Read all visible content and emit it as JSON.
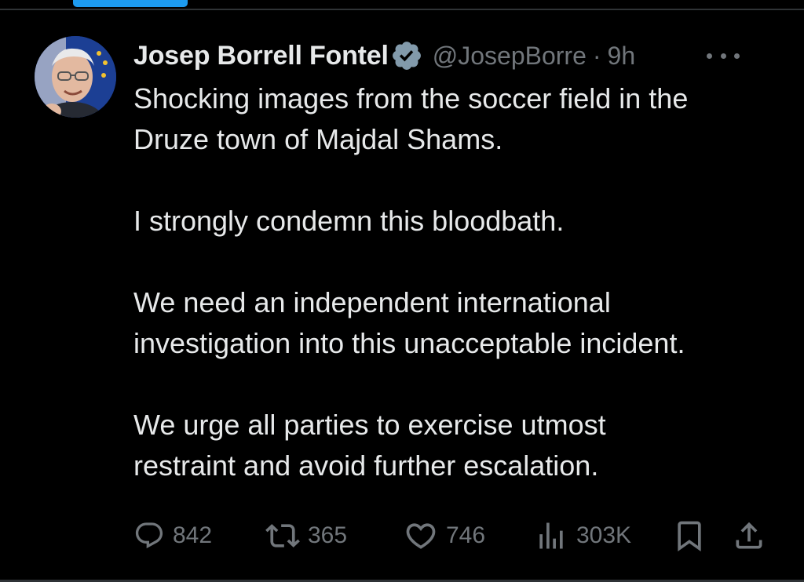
{
  "tweet": {
    "author": {
      "display_name": "Josep Borrell Fontel",
      "handle": "@JosepBorre",
      "verified": true,
      "avatar_icon": "avatar-portrait"
    },
    "separator": "·",
    "timestamp": "9h",
    "more_icon": "more-dots-icon",
    "paragraphs": [
      "Shocking images from the soccer field in the\nDruze town of Majdal Shams.",
      "I strongly condemn this bloodbath.",
      "We need an independent international\ninvestigation into this unacceptable incident.",
      "We urge all parties to exercise utmost\nrestraint and avoid further escalation."
    ],
    "actions": {
      "reply": {
        "icon": "reply-icon",
        "count": "842"
      },
      "retweet": {
        "icon": "retweet-icon",
        "count": "365"
      },
      "like": {
        "icon": "heart-icon",
        "count": "746"
      },
      "views": {
        "icon": "views-chart-icon",
        "count": "303K"
      },
      "bookmark": {
        "icon": "bookmark-icon"
      },
      "share": {
        "icon": "share-icon"
      }
    }
  },
  "colors": {
    "background": "#000000",
    "text_primary": "#e7e9ea",
    "text_secondary": "#71767b",
    "accent": "#1d9bf0",
    "divider": "#2f3336",
    "verified_badge": "#829aab"
  }
}
